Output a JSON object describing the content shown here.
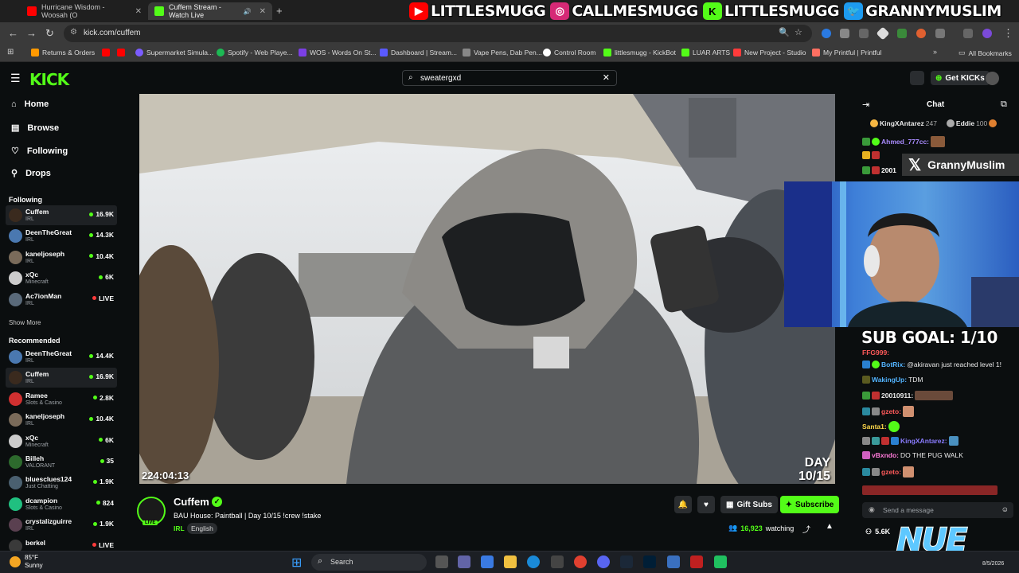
{
  "browser": {
    "tabs": [
      {
        "title": "Hurricane Wisdom - Woosah (O",
        "active": false,
        "favicon_color": "#ff0000"
      },
      {
        "title": "Cuffem Stream - Watch Live",
        "active": true,
        "favicon_color": "#53fc18"
      }
    ],
    "new_tab": "+",
    "url": "kick.com/cuffem",
    "bookmarks": [
      {
        "label": "Returns & Orders",
        "color": "#ff9900"
      },
      {
        "label": "",
        "color": "#ff0000"
      },
      {
        "label": "",
        "color": "#ff0000"
      },
      {
        "label": "Supermarket Simula...",
        "color": "#7b5cff"
      },
      {
        "label": "Spotify - Web Playe...",
        "color": "#1db954"
      },
      {
        "label": "WOS - Words On St...",
        "color": "#7b3fe4"
      },
      {
        "label": "Dashboard | Stream...",
        "color": "#5a5aff"
      },
      {
        "label": "Vape Pens, Dab Pen...",
        "color": "#888888"
      },
      {
        "label": "Control Room",
        "color": "#ffffff"
      },
      {
        "label": "littlesmugg - KickBot",
        "color": "#53fc18"
      },
      {
        "label": "LUAR ARTS",
        "color": "#53fc18"
      },
      {
        "label": "New Project - Studio",
        "color": "#ff3b3b"
      },
      {
        "label": "My Printful | Printful",
        "color": "#ff6f61"
      }
    ],
    "all_bookmarks": "All Bookmarks"
  },
  "socials": [
    {
      "icon": "youtube-icon",
      "color": "#ff0000",
      "handle": "LITTLESMUGG"
    },
    {
      "icon": "instagram-icon",
      "color": "#d62976",
      "handle": "CALLMESMUGG"
    },
    {
      "icon": "kick-icon",
      "color": "#53fc18",
      "handle": "LITTLESMUGG"
    },
    {
      "icon": "twitter-icon",
      "color": "#1d9bf0",
      "handle": "GRANNYMUSLIM"
    }
  ],
  "kick": {
    "logo": "KICK",
    "search_value": "sweatergxd",
    "get_kicks": "Get KICKs",
    "nav": [
      "Home",
      "Browse",
      "Following",
      "Drops"
    ],
    "following_header": "Following",
    "following": [
      {
        "name": "Cuffem",
        "cat": "IRL",
        "count": "16.9K",
        "live": true,
        "av": "#3a2a1e"
      },
      {
        "name": "DeenTheGreat",
        "cat": "IRL",
        "count": "14.3K",
        "live": true,
        "av": "#4a78b0"
      },
      {
        "name": "kaneljoseph",
        "cat": "IRL",
        "count": "10.4K",
        "live": true,
        "av": "#7a6b5a"
      },
      {
        "name": "xQc",
        "cat": "Minecraft",
        "count": "6K",
        "live": true,
        "av": "#cccccc"
      },
      {
        "name": "Ac7ionMan",
        "cat": "IRL",
        "count": "LIVE",
        "live": false,
        "av": "#5a6a7a"
      }
    ],
    "show_more": "Show More",
    "recommended_header": "Recommended",
    "recommended": [
      {
        "name": "DeenTheGreat",
        "cat": "IRL",
        "count": "14.4K",
        "live": true,
        "av": "#4a78b0"
      },
      {
        "name": "Cuffem",
        "cat": "IRL",
        "count": "16.9K",
        "live": true,
        "av": "#3a2a1e"
      },
      {
        "name": "Ramee",
        "cat": "Slots & Casino",
        "count": "2.8K",
        "live": true,
        "av": "#d03030"
      },
      {
        "name": "kaneljoseph",
        "cat": "IRL",
        "count": "10.4K",
        "live": true,
        "av": "#7a6b5a"
      },
      {
        "name": "xQc",
        "cat": "Minecraft",
        "count": "6K",
        "live": true,
        "av": "#cccccc"
      },
      {
        "name": "Billeh",
        "cat": "VALORANT",
        "count": "35",
        "live": true,
        "av": "#2d6a2d"
      },
      {
        "name": "bluesclues124",
        "cat": "Just Chatting",
        "count": "1.9K",
        "live": true,
        "av": "#4a6070"
      },
      {
        "name": "dcampion",
        "cat": "Slots & Casino",
        "count": "824",
        "live": true,
        "av": "#20c080"
      },
      {
        "name": "crystalizguirre",
        "cat": "IRL",
        "count": "1.9K",
        "live": true,
        "av": "#5a4050"
      },
      {
        "name": "berkel",
        "cat": "",
        "count": "LIVE",
        "live": false,
        "av": "#3a3a3a"
      }
    ]
  },
  "video": {
    "timestamp": "224:04:13",
    "day_line1": "DAY",
    "day_line2": "10/15"
  },
  "stream": {
    "name": "Cuffem",
    "title": "BAU House: Paintball | Day 10/15  !crew !stake",
    "category": "IRL",
    "language": "English",
    "live_label": "LIVE",
    "gift_subs": "Gift Subs",
    "subscribe": "Subscribe",
    "watching_count": "16,923",
    "watching_label": "watching"
  },
  "chat": {
    "title": "Chat",
    "top_gifters": [
      {
        "name": "KingXAntarez",
        "value": "247"
      },
      {
        "name": "Eddie",
        "value": "100"
      }
    ],
    "messages": [
      {
        "user": "Ahmed_777cc:",
        "text": "",
        "color": "#a98bff"
      },
      {
        "user": "FFG999:",
        "text": "",
        "color": "#ff5a5a"
      },
      {
        "user": "BotRix:",
        "text": "@akiravan just reached level 1!",
        "color": "#53b4ff"
      },
      {
        "user": "WakingUp:",
        "text": "TDM",
        "color": "#53b4ff"
      },
      {
        "user": "20010911:",
        "text": "",
        "color": "#ffffff"
      },
      {
        "user": "gzeto:",
        "text": "",
        "color": "#ff5a5a"
      },
      {
        "user": "Santa1:",
        "text": "",
        "color": "#ffd84a"
      },
      {
        "user": "KingXAntarez:",
        "text": "",
        "color": "#8a7cff"
      },
      {
        "user": "vBxndo:",
        "text": "DO THE PUG WALK",
        "color": "#ff7ad9"
      },
      {
        "user": "gzeto:",
        "text": "",
        "color": "#ff5a5a"
      }
    ],
    "input_placeholder": "Send a message",
    "viewer_count": "5.6K",
    "sub_goal": "SUB GOAL: 1/10"
  },
  "overlay": {
    "x_handle": "GrannyMuslim",
    "nue_logo": "NUE"
  },
  "taskbar": {
    "temp": "85°F",
    "weather": "Sunny",
    "search": "Search",
    "date": "8/5/2026"
  }
}
